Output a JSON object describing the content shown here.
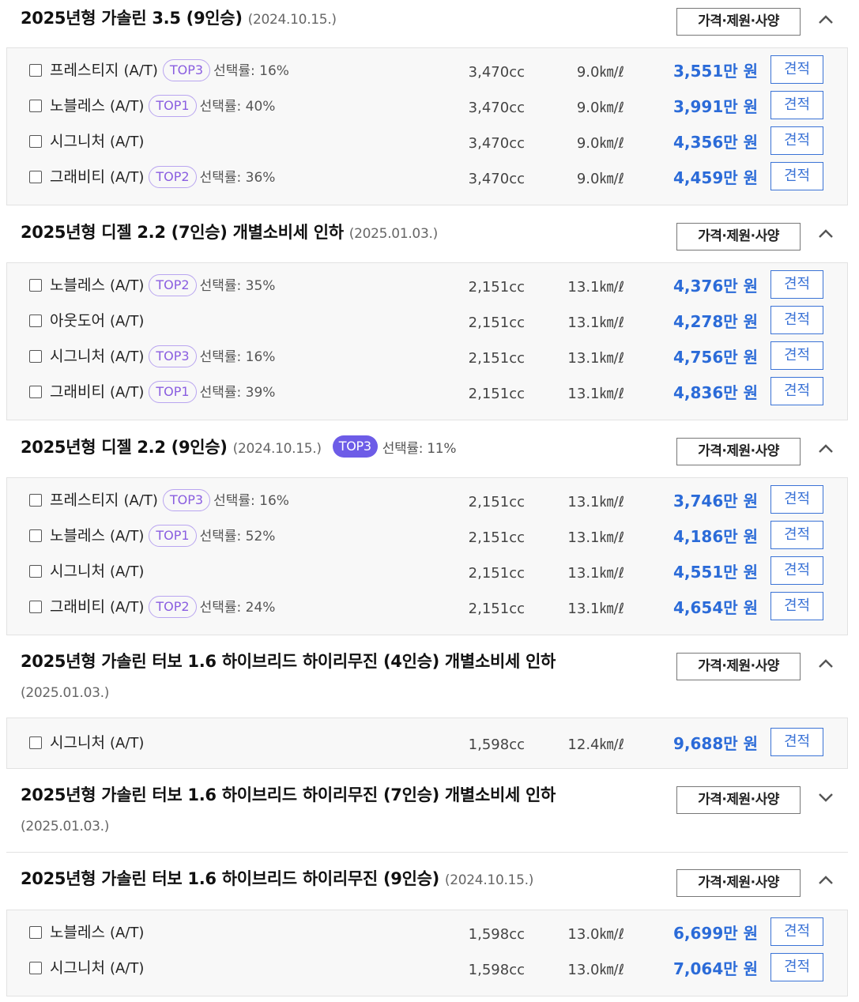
{
  "labels": {
    "spec_button": "가격·제원·사양",
    "quote_button": "견적",
    "transmission": "(A/T)",
    "rate_prefix": "선택률: ",
    "price_unit": "만 원"
  },
  "sections": [
    {
      "title": "2025년형 가솔린 3.5 (9인승)",
      "date": "(2024.10.15.)",
      "expanded": true,
      "rows": [
        {
          "trim": "프레스티지",
          "badge": "TOP3",
          "rate": "선택률: 16%",
          "cc": "3,470cc",
          "eff": "9.0㎞/ℓ",
          "price": "3,551"
        },
        {
          "trim": "노블레스",
          "badge": "TOP1",
          "rate": "선택률: 40%",
          "cc": "3,470cc",
          "eff": "9.0㎞/ℓ",
          "price": "3,991"
        },
        {
          "trim": "시그니처",
          "badge": "",
          "rate": "",
          "cc": "3,470cc",
          "eff": "9.0㎞/ℓ",
          "price": "4,356"
        },
        {
          "trim": "그래비티",
          "badge": "TOP2",
          "rate": "선택률: 36%",
          "cc": "3,470cc",
          "eff": "9.0㎞/ℓ",
          "price": "4,459"
        }
      ]
    },
    {
      "title": "2025년형 디젤 2.2 (7인승) 개별소비세 인하",
      "date": "(2025.01.03.)",
      "expanded": true,
      "rows": [
        {
          "trim": "노블레스",
          "badge": "TOP2",
          "rate": "선택률: 35%",
          "cc": "2,151cc",
          "eff": "13.1㎞/ℓ",
          "price": "4,376"
        },
        {
          "trim": "아웃도어",
          "badge": "",
          "rate": "",
          "cc": "2,151cc",
          "eff": "13.1㎞/ℓ",
          "price": "4,278"
        },
        {
          "trim": "시그니처",
          "badge": "TOP3",
          "rate": "선택률: 16%",
          "cc": "2,151cc",
          "eff": "13.1㎞/ℓ",
          "price": "4,756"
        },
        {
          "trim": "그래비티",
          "badge": "TOP1",
          "rate": "선택률: 39%",
          "cc": "2,151cc",
          "eff": "13.1㎞/ℓ",
          "price": "4,836"
        }
      ]
    },
    {
      "title": "2025년형 디젤 2.2 (9인승)",
      "date": "(2024.10.15.)",
      "badge": "TOP3",
      "rate": "선택률: 11%",
      "expanded": true,
      "rows": [
        {
          "trim": "프레스티지",
          "badge": "TOP3",
          "rate": "선택률: 16%",
          "cc": "2,151cc",
          "eff": "13.1㎞/ℓ",
          "price": "3,746"
        },
        {
          "trim": "노블레스",
          "badge": "TOP1",
          "rate": "선택률: 52%",
          "cc": "2,151cc",
          "eff": "13.1㎞/ℓ",
          "price": "4,186"
        },
        {
          "trim": "시그니처",
          "badge": "",
          "rate": "",
          "cc": "2,151cc",
          "eff": "13.1㎞/ℓ",
          "price": "4,551"
        },
        {
          "trim": "그래비티",
          "badge": "TOP2",
          "rate": "선택률: 24%",
          "cc": "2,151cc",
          "eff": "13.1㎞/ℓ",
          "price": "4,654"
        }
      ]
    },
    {
      "title": "2025년형 가솔린 터보 1.6 하이브리드 하이리무진 (4인승) 개별소비세 인하",
      "date": "(2025.01.03.)",
      "expanded": true,
      "rows": [
        {
          "trim": "시그니처",
          "badge": "",
          "rate": "",
          "cc": "1,598cc",
          "eff": "12.4㎞/ℓ",
          "price": "9,688"
        }
      ]
    },
    {
      "title": "2025년형 가솔린 터보 1.6 하이브리드 하이리무진 (7인승) 개별소비세 인하",
      "date": "(2025.01.03.)",
      "expanded": false,
      "rows": []
    },
    {
      "title": "2025년형 가솔린 터보 1.6 하이브리드 하이리무진 (9인승)",
      "date": "(2024.10.15.)",
      "expanded": true,
      "rows": [
        {
          "trim": "노블레스",
          "badge": "",
          "rate": "",
          "cc": "1,598cc",
          "eff": "13.0㎞/ℓ",
          "price": "6,699"
        },
        {
          "trim": "시그니처",
          "badge": "",
          "rate": "",
          "cc": "1,598cc",
          "eff": "13.0㎞/ℓ",
          "price": "7,064"
        }
      ]
    }
  ],
  "colors": {
    "price": "#2b6bd8",
    "badge_outline": "#b9a5f0",
    "badge_filled": "#6d5ce7"
  }
}
